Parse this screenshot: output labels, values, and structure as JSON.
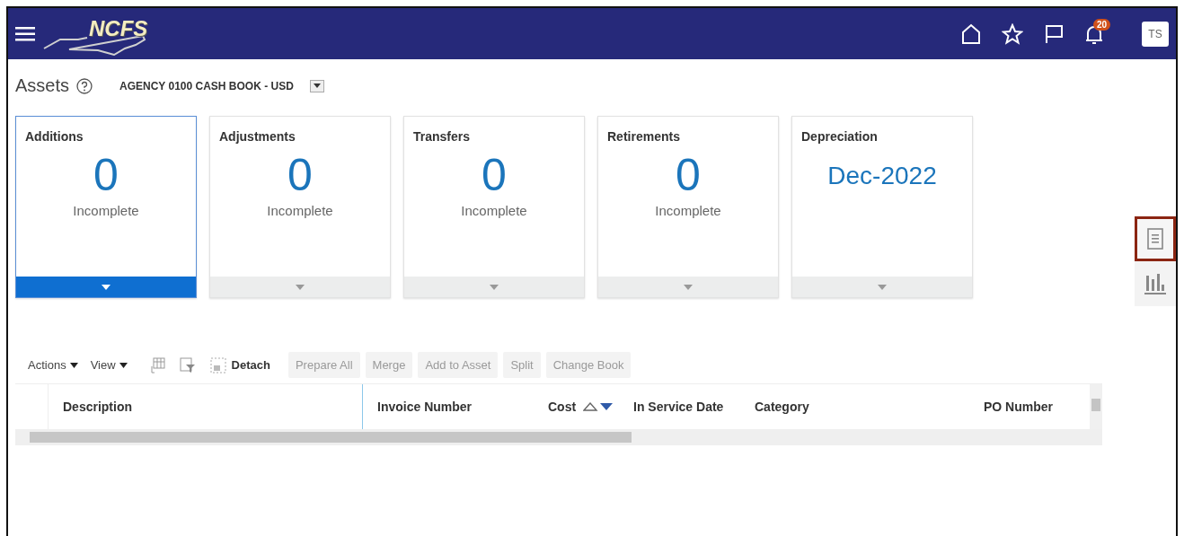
{
  "header": {
    "logo_text": "NCFS",
    "notification_count": "20",
    "avatar": "TS"
  },
  "page": {
    "title": "Assets",
    "book": "AGENCY 0100 CASH BOOK - USD"
  },
  "tiles": [
    {
      "title": "Additions",
      "value": "0",
      "caption": "Incomplete",
      "selected": true
    },
    {
      "title": "Adjustments",
      "value": "0",
      "caption": "Incomplete",
      "selected": false
    },
    {
      "title": "Transfers",
      "value": "0",
      "caption": "Incomplete",
      "selected": false
    },
    {
      "title": "Retirements",
      "value": "0",
      "caption": "Incomplete",
      "selected": false
    },
    {
      "title": "Depreciation",
      "value": "Dec-2022",
      "selected": false
    }
  ],
  "side_panel": [
    {
      "kind": "list",
      "selected": true
    },
    {
      "kind": "chart",
      "selected": false
    }
  ],
  "toolbar": {
    "menus": [
      "Actions",
      "View"
    ],
    "detach": "Detach",
    "buttons": [
      {
        "label": "Prepare All",
        "disabled": true
      },
      {
        "label": "Merge",
        "disabled": true
      },
      {
        "label": "Add to Asset",
        "disabled": true
      },
      {
        "label": "Split",
        "disabled": true
      },
      {
        "label": "Change Book",
        "disabled": true
      }
    ]
  },
  "table": {
    "columns": [
      {
        "label": "Description"
      },
      {
        "label": "Invoice Number"
      },
      {
        "label": "Cost",
        "sortable": true
      },
      {
        "label": "In Service Date"
      },
      {
        "label": "Category"
      },
      {
        "label": "PO Number"
      }
    ]
  }
}
